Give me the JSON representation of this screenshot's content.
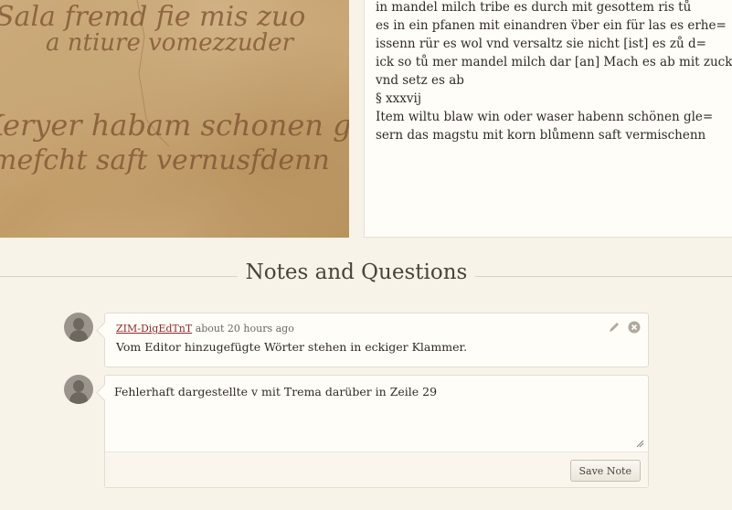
{
  "manuscript": {
    "script_lines": [
      "Sala fremd fie mis zuo",
      "a ntiure vomezzuder",
      "Keryer habam schonen gle",
      "mefcht saft vernusfdenn"
    ]
  },
  "transcription": {
    "lines": [
      "in mandel milch tribe es durch mit gesottem ris tů",
      "es in ein pfanen mit einandren v̈ber ein für las es erhe=",
      "issenn rür es wol vnd versaltz sie nicht [ist] es zů d=",
      "ick so tů mer mandel milch dar [an] Mach es ab mit zucker",
      "vnd setz es ab",
      "§ xxxvij",
      "Item wiltu blaw win oder waser habenn schönen gle=",
      "sern das magstu mit korn blůmenn saft vermischenn"
    ]
  },
  "notes": {
    "title": "Notes and Questions",
    "items": [
      {
        "author": "ZIM-DigEdTnT",
        "time": "about 20 hours ago",
        "body": "Vom Editor hinzugefügte Wörter stehen in eckiger Klammer."
      }
    ],
    "new_note": {
      "value": "Fehlerhaft dargestellte v mit Trema darüber in Zeile 29",
      "save_label": "Save Note"
    }
  },
  "icons": {
    "edit": "pencil-icon",
    "delete": "close-circle-icon",
    "avatar": "user-silhouette-icon"
  }
}
